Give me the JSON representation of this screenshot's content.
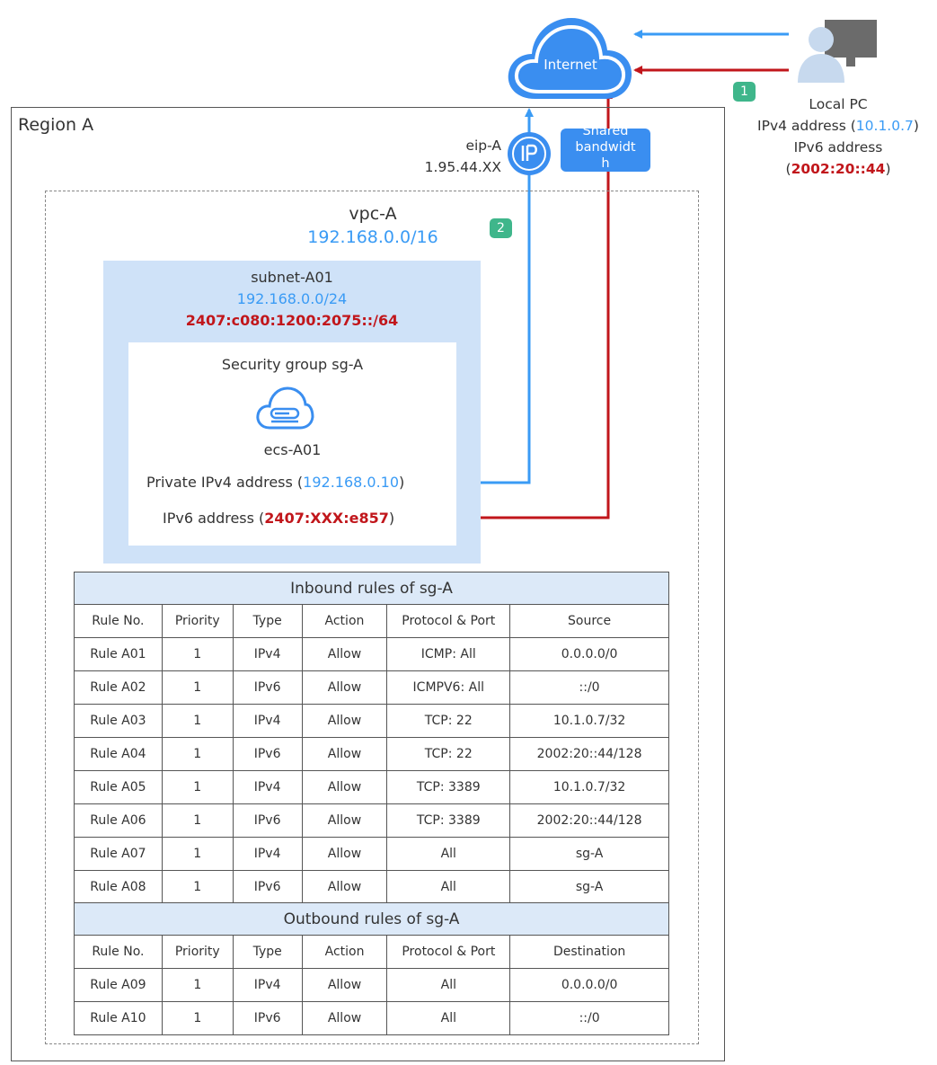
{
  "internet": {
    "label": "Internet"
  },
  "badges": {
    "one": "1",
    "two": "2"
  },
  "local_pc": {
    "title": "Local PC",
    "ipv4_prefix": "IPv4 address (",
    "ipv4": "10.1.0.7",
    "ipv4_suffix": ")",
    "ipv6_label": "IPv6 address",
    "ipv6_prefix": "(",
    "ipv6": "2002:20::44",
    "ipv6_suffix": ")"
  },
  "region": {
    "label": "Region A"
  },
  "eip": {
    "name": "eip-A",
    "address": "1.95.44.XX"
  },
  "bandwidth": {
    "line1": "Shared",
    "line2": "bandwidt",
    "line3": "h"
  },
  "vpc": {
    "name": "vpc-A",
    "cidr": "192.168.0.0/16"
  },
  "subnet": {
    "name": "subnet-A01",
    "ipv4_cidr": "192.168.0.0/24",
    "ipv6_cidr": "2407:c080:1200:2075::/64"
  },
  "security_group": {
    "label": "Security group sg-A"
  },
  "ecs": {
    "name": "ecs-A01",
    "ipv4_prefix": "Private IPv4 address (",
    "ipv4": "192.168.0.10",
    "ipv4_suffix": ")",
    "ipv6_prefix": "IPv6 address (",
    "ipv6": "2407:XXX:e857",
    "ipv6_suffix": ")"
  },
  "inbound": {
    "title": "Inbound rules of sg-A",
    "headers": [
      "Rule No.",
      "Priority",
      "Type",
      "Action",
      "Protocol & Port",
      "Source"
    ],
    "rows": [
      [
        "Rule A01",
        "1",
        "IPv4",
        "Allow",
        "ICMP: All",
        "0.0.0.0/0"
      ],
      [
        "Rule A02",
        "1",
        "IPv6",
        "Allow",
        "ICMPV6: All",
        "::/0"
      ],
      [
        "Rule A03",
        "1",
        "IPv4",
        "Allow",
        "TCP: 22",
        "10.1.0.7/32"
      ],
      [
        "Rule A04",
        "1",
        "IPv6",
        "Allow",
        "TCP: 22",
        "2002:20::44/128"
      ],
      [
        "Rule A05",
        "1",
        "IPv4",
        "Allow",
        "TCP: 3389",
        "10.1.0.7/32"
      ],
      [
        "Rule A06",
        "1",
        "IPv6",
        "Allow",
        "TCP: 3389",
        "2002:20::44/128"
      ],
      [
        "Rule A07",
        "1",
        "IPv4",
        "Allow",
        "All",
        "sg-A"
      ],
      [
        "Rule A08",
        "1",
        "IPv6",
        "Allow",
        "All",
        "sg-A"
      ]
    ]
  },
  "outbound": {
    "title": "Outbound rules of sg-A",
    "headers": [
      "Rule No.",
      "Priority",
      "Type",
      "Action",
      "Protocol & Port",
      "Destination"
    ],
    "rows": [
      [
        "Rule A09",
        "1",
        "IPv4",
        "Allow",
        "All",
        "0.0.0.0/0"
      ],
      [
        "Rule A10",
        "1",
        "IPv6",
        "Allow",
        "All",
        "::/0"
      ]
    ]
  },
  "colors": {
    "ipv4": "#3a9bf5",
    "ipv6": "#c1161b",
    "accent": "#3a8ef0",
    "badge": "#3fb68b",
    "subnet_bg": "#cfe2f8"
  }
}
